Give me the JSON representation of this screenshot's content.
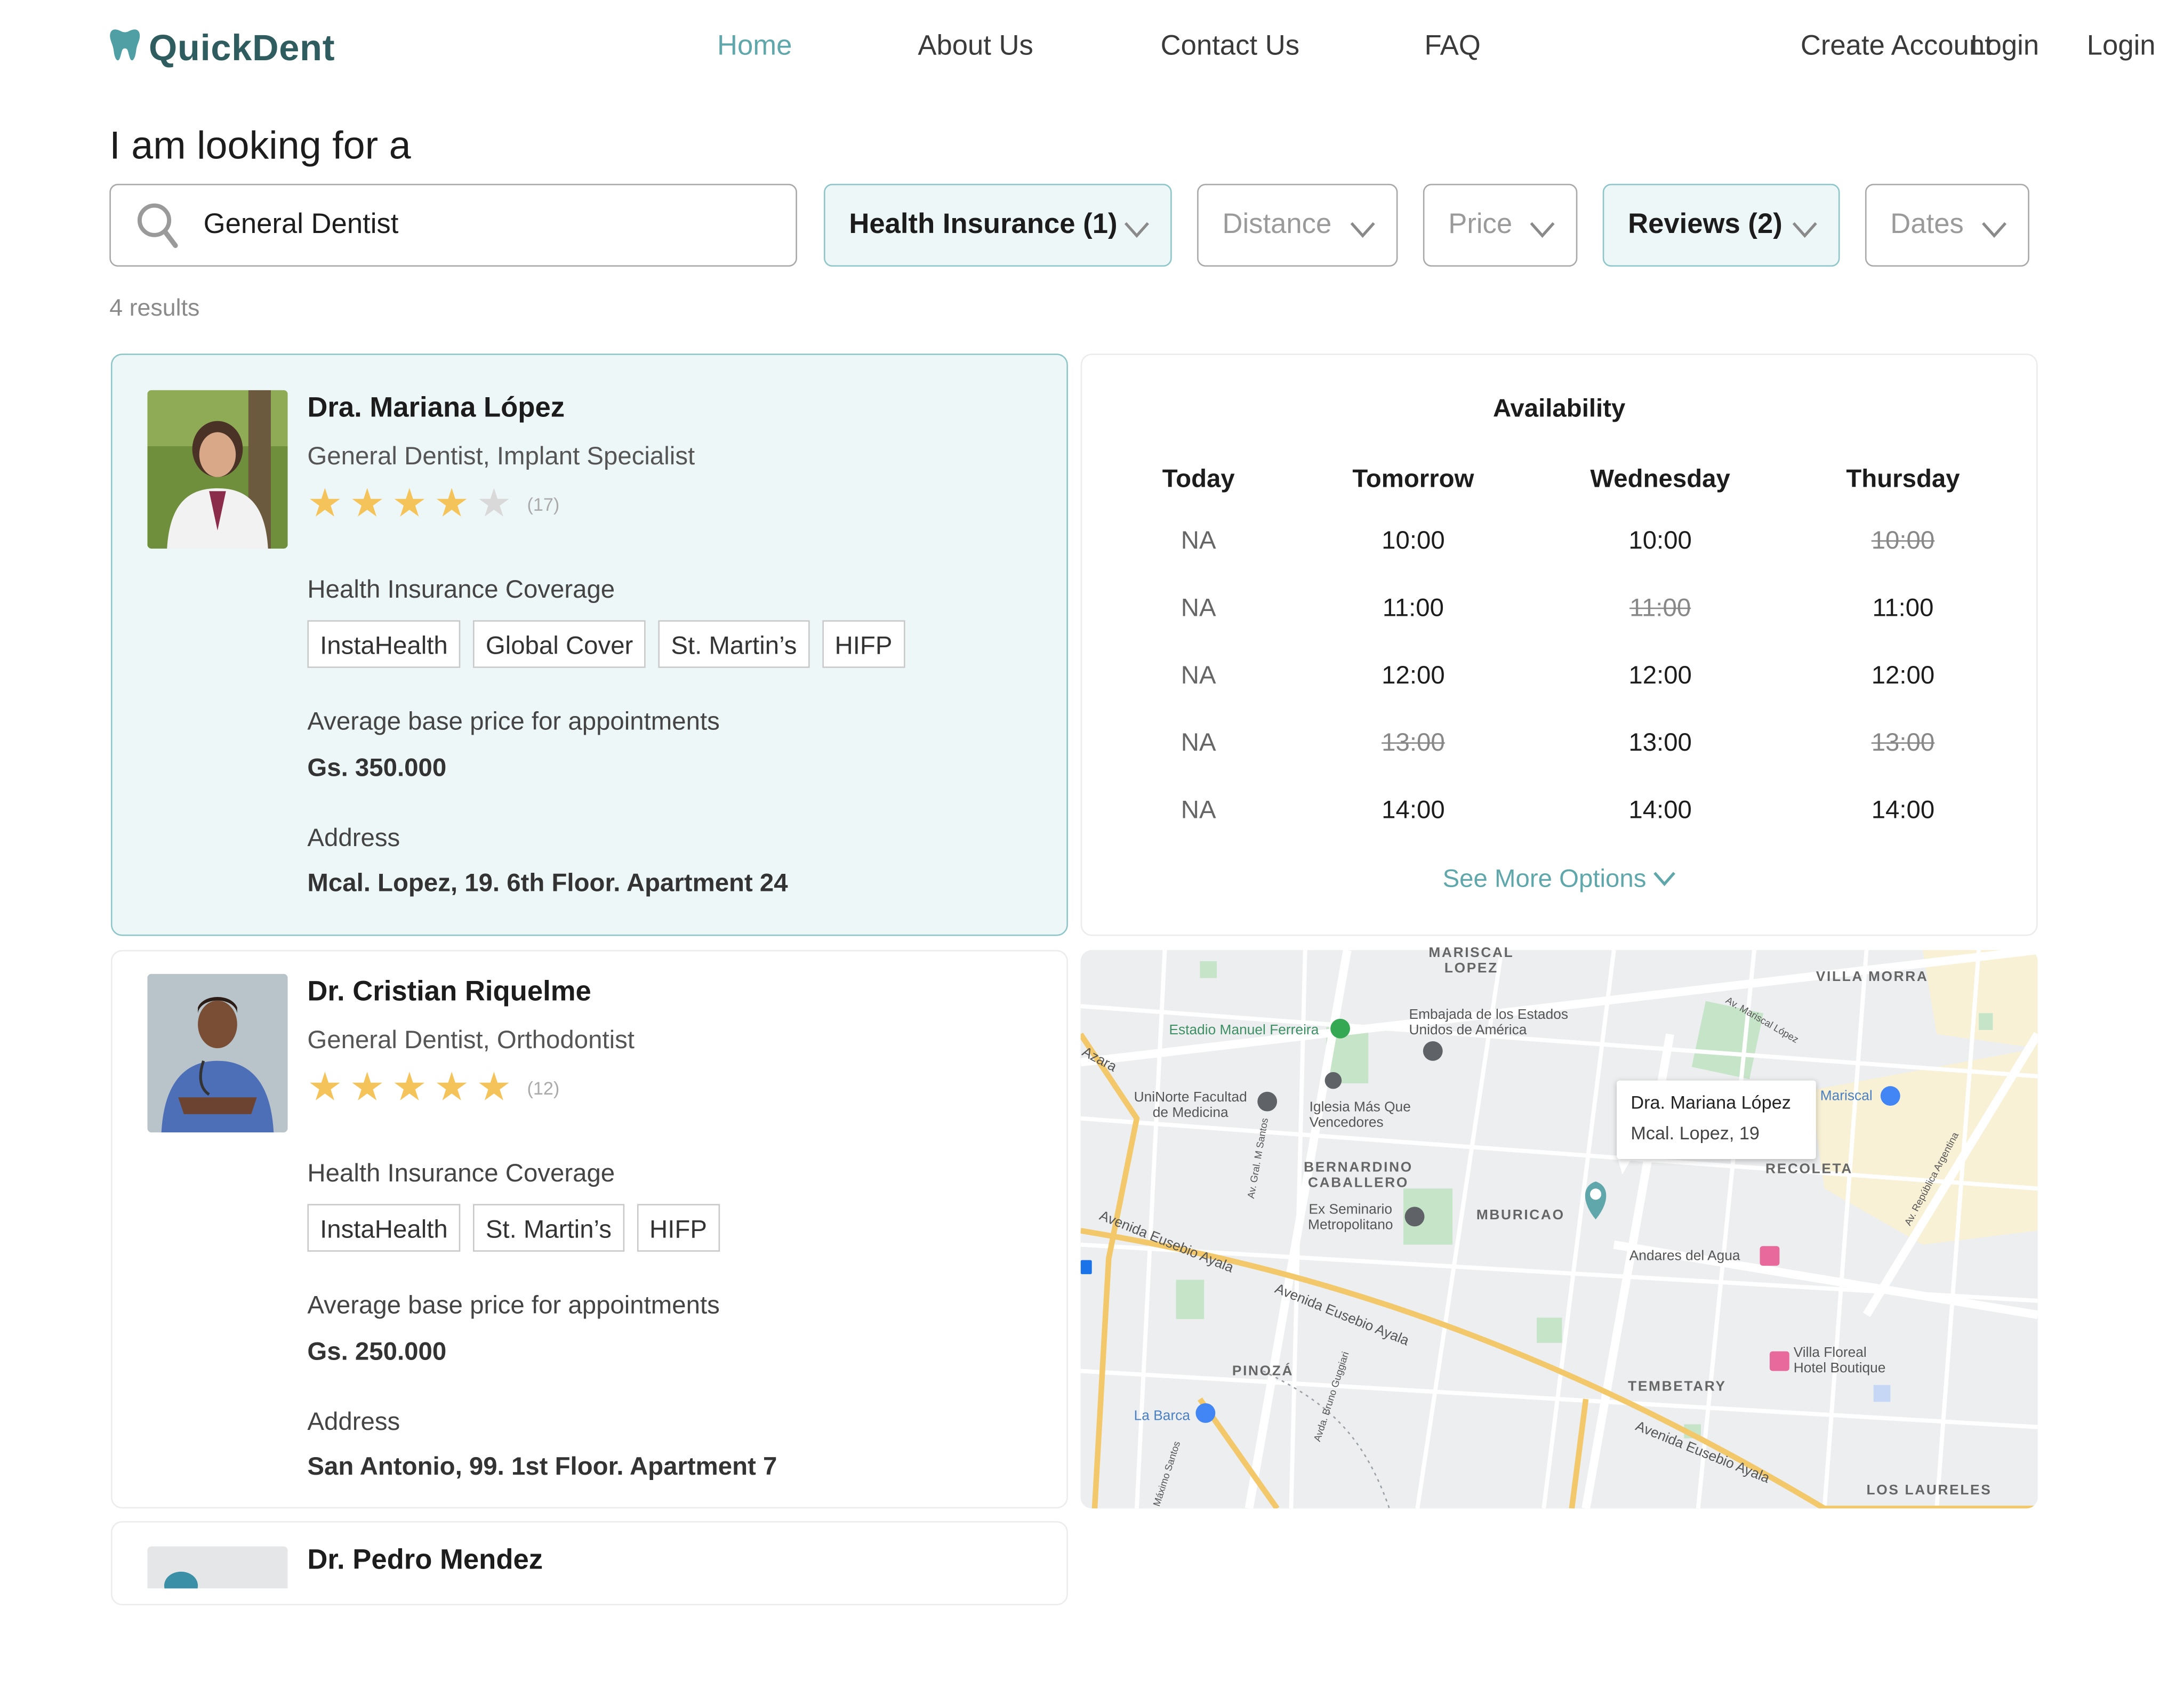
{
  "header": {
    "logo": "QuickDent",
    "nav": [
      "Home",
      "About Us",
      "Contact Us",
      "FAQ"
    ],
    "create_account": "Create Account",
    "login_overlap": "Login",
    "login": "Login"
  },
  "search": {
    "headline": "I am looking for a",
    "query": "General Dentist",
    "filters": {
      "insurance": "Health Insurance (1)",
      "distance": "Distance",
      "price": "Price",
      "reviews": "Reviews (2)",
      "dates": "Dates"
    },
    "results": "4 results"
  },
  "doctors": [
    {
      "name": "Dra. Mariana López",
      "specialty": "General Dentist, Implant Specialist",
      "rating": 4,
      "review_count": "(17)",
      "insurance_label": "Health Insurance Coverage",
      "insurances": [
        "InstaHealth",
        "Global Cover",
        "St. Martin’s",
        "HIFP"
      ],
      "price_label": "Average base price for appointments",
      "price": "Gs. 350.000",
      "address_label": "Address",
      "address": "Mcal. Lopez, 19. 6th Floor. Apartment 24"
    },
    {
      "name": "Dr. Cristian Riquelme",
      "specialty": "General Dentist, Orthodontist",
      "rating": 5,
      "review_count": "(12)",
      "insurance_label": "Health Insurance Coverage",
      "insurances": [
        "InstaHealth",
        "St. Martin’s",
        "HIFP"
      ],
      "price_label": "Average base price for appointments",
      "price": "Gs. 250.000",
      "address_label": "Address",
      "address": "San Antonio, 99. 1st Floor. Apartment 7"
    },
    {
      "name": "Dr. Pedro Mendez"
    }
  ],
  "availability": {
    "title": "Availability",
    "days": [
      "Today",
      "Tomorrow",
      "Wednesday",
      "Thursday"
    ],
    "rows": [
      [
        {
          "t": "NA",
          "s": "na"
        },
        {
          "t": "10:00",
          "s": "open"
        },
        {
          "t": "10:00",
          "s": "open"
        },
        {
          "t": "10:00",
          "s": "taken"
        }
      ],
      [
        {
          "t": "NA",
          "s": "na"
        },
        {
          "t": "11:00",
          "s": "open"
        },
        {
          "t": "11:00",
          "s": "taken"
        },
        {
          "t": "11:00",
          "s": "open"
        }
      ],
      [
        {
          "t": "NA",
          "s": "na"
        },
        {
          "t": "12:00",
          "s": "open"
        },
        {
          "t": "12:00",
          "s": "open"
        },
        {
          "t": "12:00",
          "s": "open"
        }
      ],
      [
        {
          "t": "NA",
          "s": "na"
        },
        {
          "t": "13:00",
          "s": "taken"
        },
        {
          "t": "13:00",
          "s": "open"
        },
        {
          "t": "13:00",
          "s": "taken"
        }
      ],
      [
        {
          "t": "NA",
          "s": "na"
        },
        {
          "t": "14:00",
          "s": "open"
        },
        {
          "t": "14:00",
          "s": "open"
        },
        {
          "t": "14:00",
          "s": "open"
        }
      ]
    ],
    "see_more": "See More Options"
  },
  "map": {
    "popup_name": "Dra. Mariana López",
    "popup_address": "Mcal. Lopez, 19",
    "labels": {
      "mariscal_lopez": "MARISCAL\nLOPEZ",
      "villa_morra": "VILLA MORRA",
      "embajada": "Embajada de los Estados\nUnidos de América",
      "estadio": "Estadio Manuel Ferreira",
      "azara": "Azara",
      "uninorte": "UniNorte Facultad\nde Medicina",
      "iglesia": "Iglesia Más Que\nVencedores",
      "mariscal": "Mariscal",
      "bernardino": "BERNARDINO\nCABALLERO",
      "recoleta": "RECOLETA",
      "seminario": "Ex Seminario\nMetropolitano",
      "mburicao": "MBURICAO",
      "andares": "Andares del Agua",
      "eusebio1": "Avenida Eusebio Ayala",
      "eusebio2": "Avenida Eusebio Ayala",
      "eusebio3": "Avenida Eusebio Ayala",
      "villa_floreal": "Villa Floreal\nHotel Boutique",
      "pinoza": "PINOZÁ",
      "tembetary": "TEMBETARY",
      "la_barca": "La Barca",
      "los_laureles": "LOS LAURELES",
      "gral_santos": "Av. Gral. M Santos",
      "bruno_guggiari": "Avda. Bruno Guggiari",
      "republica_argentina": "Av. República Argentina",
      "mariscal_lopez_av": "Av. Mariscal López",
      "maximo_santos": "Máximo Santos"
    }
  }
}
